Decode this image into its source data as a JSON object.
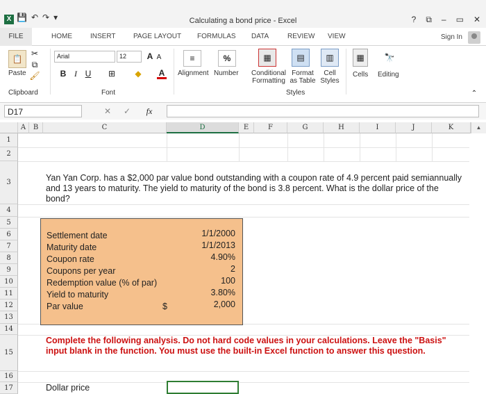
{
  "window": {
    "title": "Calculating a bond price - Excel",
    "help": "?",
    "restore": "⧉",
    "minimize": "–",
    "maximize": "▭",
    "close": "✕"
  },
  "qat": {
    "save": "💾",
    "undo": "↶",
    "redo": "↷",
    "more": "▾"
  },
  "tabs": {
    "file": "FILE",
    "items": [
      "HOME",
      "INSERT",
      "PAGE LAYOUT",
      "FORMULAS",
      "DATA",
      "REVIEW",
      "VIEW"
    ],
    "sign_in": "Sign In"
  },
  "ribbon": {
    "paste": "Paste",
    "clipboard": "Clipboard",
    "font_name": "Arial",
    "font_size": "12",
    "font_group": "Font",
    "bold": "B",
    "italic": "I",
    "underline": "U",
    "alignment": "Alignment",
    "number": "Number",
    "percent": "%",
    "conditional_formatting": "Conditional Formatting",
    "format_as_table": "Format as Table",
    "cell_styles": "Cell Styles",
    "styles_group": "Styles",
    "cells": "Cells",
    "editing": "Editing",
    "grow_font": "A",
    "shrink_font": "A"
  },
  "formula_bar": {
    "name_box": "D17",
    "fx": "fx",
    "cancel": "✕",
    "enter": "✓",
    "formula": ""
  },
  "grid": {
    "columns": [
      "A",
      "B",
      "C",
      "D",
      "E",
      "F",
      "G",
      "H",
      "I",
      "J",
      "K"
    ],
    "rows": [
      "1",
      "2",
      "3",
      "4",
      "5",
      "6",
      "7",
      "8",
      "9",
      "10",
      "11",
      "12",
      "13",
      "14",
      "15",
      "16",
      "17"
    ],
    "problem": "Yan Yan Corp. has a $2,000 par value bond outstanding with a coupon rate of 4.9 percent paid semiannually and 13 years to maturity. The yield to maturity of the bond is 3.8 percent. What is the dollar price of the bond?",
    "inputs": [
      {
        "label": "Settlement date",
        "value": "1/1/2000"
      },
      {
        "label": "Maturity date",
        "value": "1/1/2013"
      },
      {
        "label": "Coupon rate",
        "value": "4.90%"
      },
      {
        "label": "Coupons per year",
        "value": "2"
      },
      {
        "label": "Redemption value (% of par)",
        "value": "100"
      },
      {
        "label": "Yield to maturity",
        "value": "3.80%"
      },
      {
        "label": "Par value",
        "value": "2,000",
        "currency": "$"
      }
    ],
    "instructions": "Complete the following analysis. Do not hard code values in your calculations. Leave the \"Basis\" input blank in the function. You must use the built-in Excel function to answer this question.",
    "dollar_price_label": "Dollar price",
    "dollar_price_value": ""
  }
}
